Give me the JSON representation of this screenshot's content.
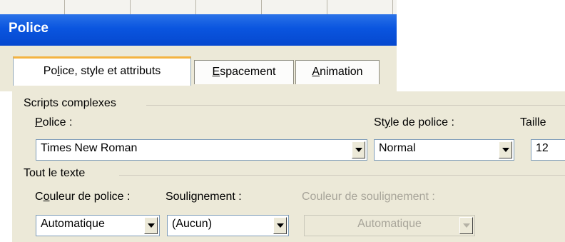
{
  "dialog": {
    "title": "Police"
  },
  "tabs": [
    {
      "before": "Po",
      "key": "l",
      "after": "ice, style et attributs"
    },
    {
      "before": "",
      "key": "E",
      "after": "spacement"
    },
    {
      "before": "",
      "key": "A",
      "after": "nimation"
    }
  ],
  "scripts_section": {
    "heading": "Scripts complexes",
    "font_label": {
      "before": "",
      "key": "P",
      "after": "olice :"
    },
    "font_value": "Times New Roman",
    "style_label": {
      "before": "St",
      "key": "y",
      "after": "le de police :"
    },
    "style_value": "Normal",
    "size_label": "Taille",
    "size_value": "12"
  },
  "all_text_section": {
    "heading": "Tout le texte",
    "color_label": {
      "before": "C",
      "key": "o",
      "after": "uleur de police :"
    },
    "color_value": "Automatique",
    "underline_label": {
      "before": "Souli",
      "key": "g",
      "after": "nement :"
    },
    "underline_value": "(Aucun)",
    "underline_color_label": "Couleur de soulignement :",
    "underline_color_value": "Automatique"
  },
  "colors": {
    "title_bar": "#0a55df",
    "dialog_bg": "#ece9d8",
    "active_tab_accent": "#f4b340",
    "combo_border": "#7f9db9"
  }
}
